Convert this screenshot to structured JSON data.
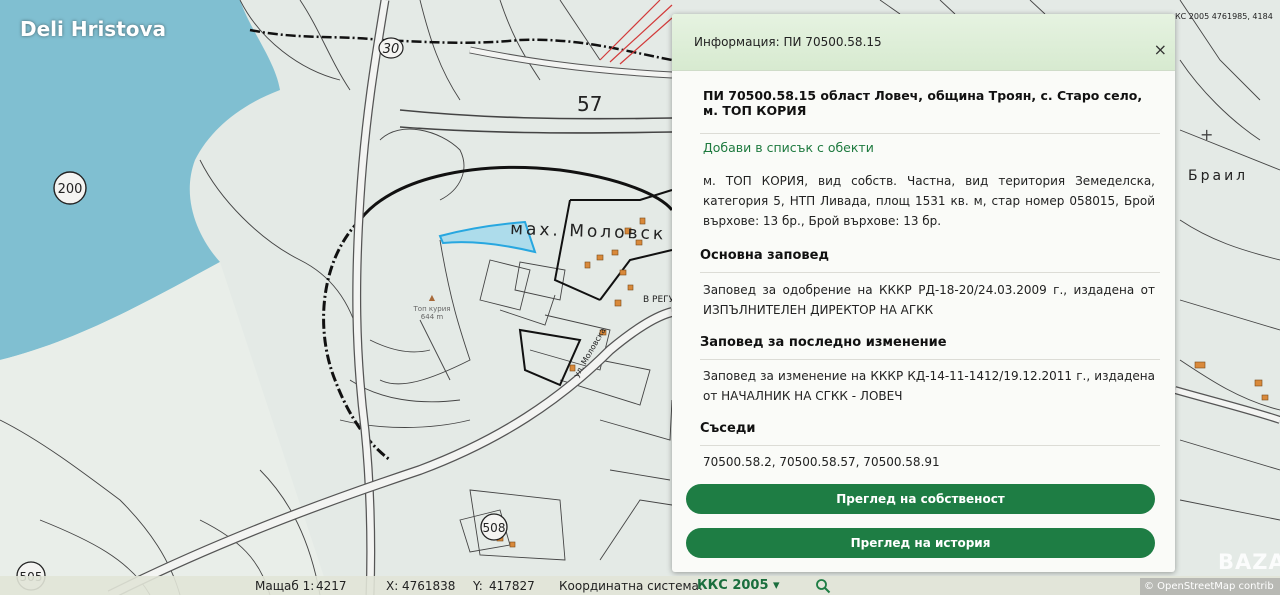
{
  "watermark": "Deli Hristova",
  "map": {
    "labels": {
      "road_30": "30",
      "road_57": "57",
      "road_200": "200",
      "road_508": "508",
      "road_505": "505",
      "settlement": "мах. Моловск",
      "peak_name": "Топ курия",
      "peak_height": "644 m",
      "village_right": "Браил",
      "street_moloska": "ул. Моловска",
      "street_regu": "В РЕГУ",
      "corner_coords": "КС 2005 4761985, 4184"
    },
    "colors": {
      "water": "#6fb7cc",
      "parcel_highlight": "#27a7e0",
      "building": "#d9893a"
    }
  },
  "panel": {
    "header_title": "Информация: ПИ 70500.58.15",
    "close_symbol": "×",
    "parcel_title": "ПИ 70500.58.15 област Ловеч, община Троян, с. Старо село, м. ТОП КОРИЯ",
    "add_to_list": "Добави в списък с обекти",
    "description": "м. ТОП КОРИЯ, вид собств. Частна, вид територия Земеделска, категория 5, НТП Ливада, площ 1531 кв. м, стар номер 058015, Брой върхове: 13 бр., Брой върхове: 13 бр.",
    "order_title": "Основна заповед",
    "order_text": "Заповед за одобрение на КККР РД-18-20/24.03.2009 г., издадена от ИЗПЪЛНИТЕЛЕН ДИРЕКТОР НА АГКК",
    "last_change_title": "Заповед за последно изменение",
    "last_change_text": "Заповед за изменение на КККР КД-14-11-1412/19.12.2011 г., издадена от НАЧАЛНИК НА СГКК - ЛОВЕЧ",
    "neighbors_title": "Съседи",
    "neighbors_text": "70500.58.2, 70500.58.57, 70500.58.91",
    "btn_ownership": "Преглед на собственост",
    "btn_history": "Преглед на история",
    "accent_color": "#1e7d44"
  },
  "statusbar": {
    "scale_label": "Мащаб 1:",
    "scale_value": "4217",
    "x_label": "X:",
    "x_value": "4761838",
    "y_label": "Y:",
    "y_value": "417827",
    "coord_label": "Координатна система:",
    "coord_value": "ККС 2005 ▾",
    "search_icon": "search-icon"
  },
  "attribution": "© OpenStreetMap contrib",
  "site_watermark": "BAZAR"
}
